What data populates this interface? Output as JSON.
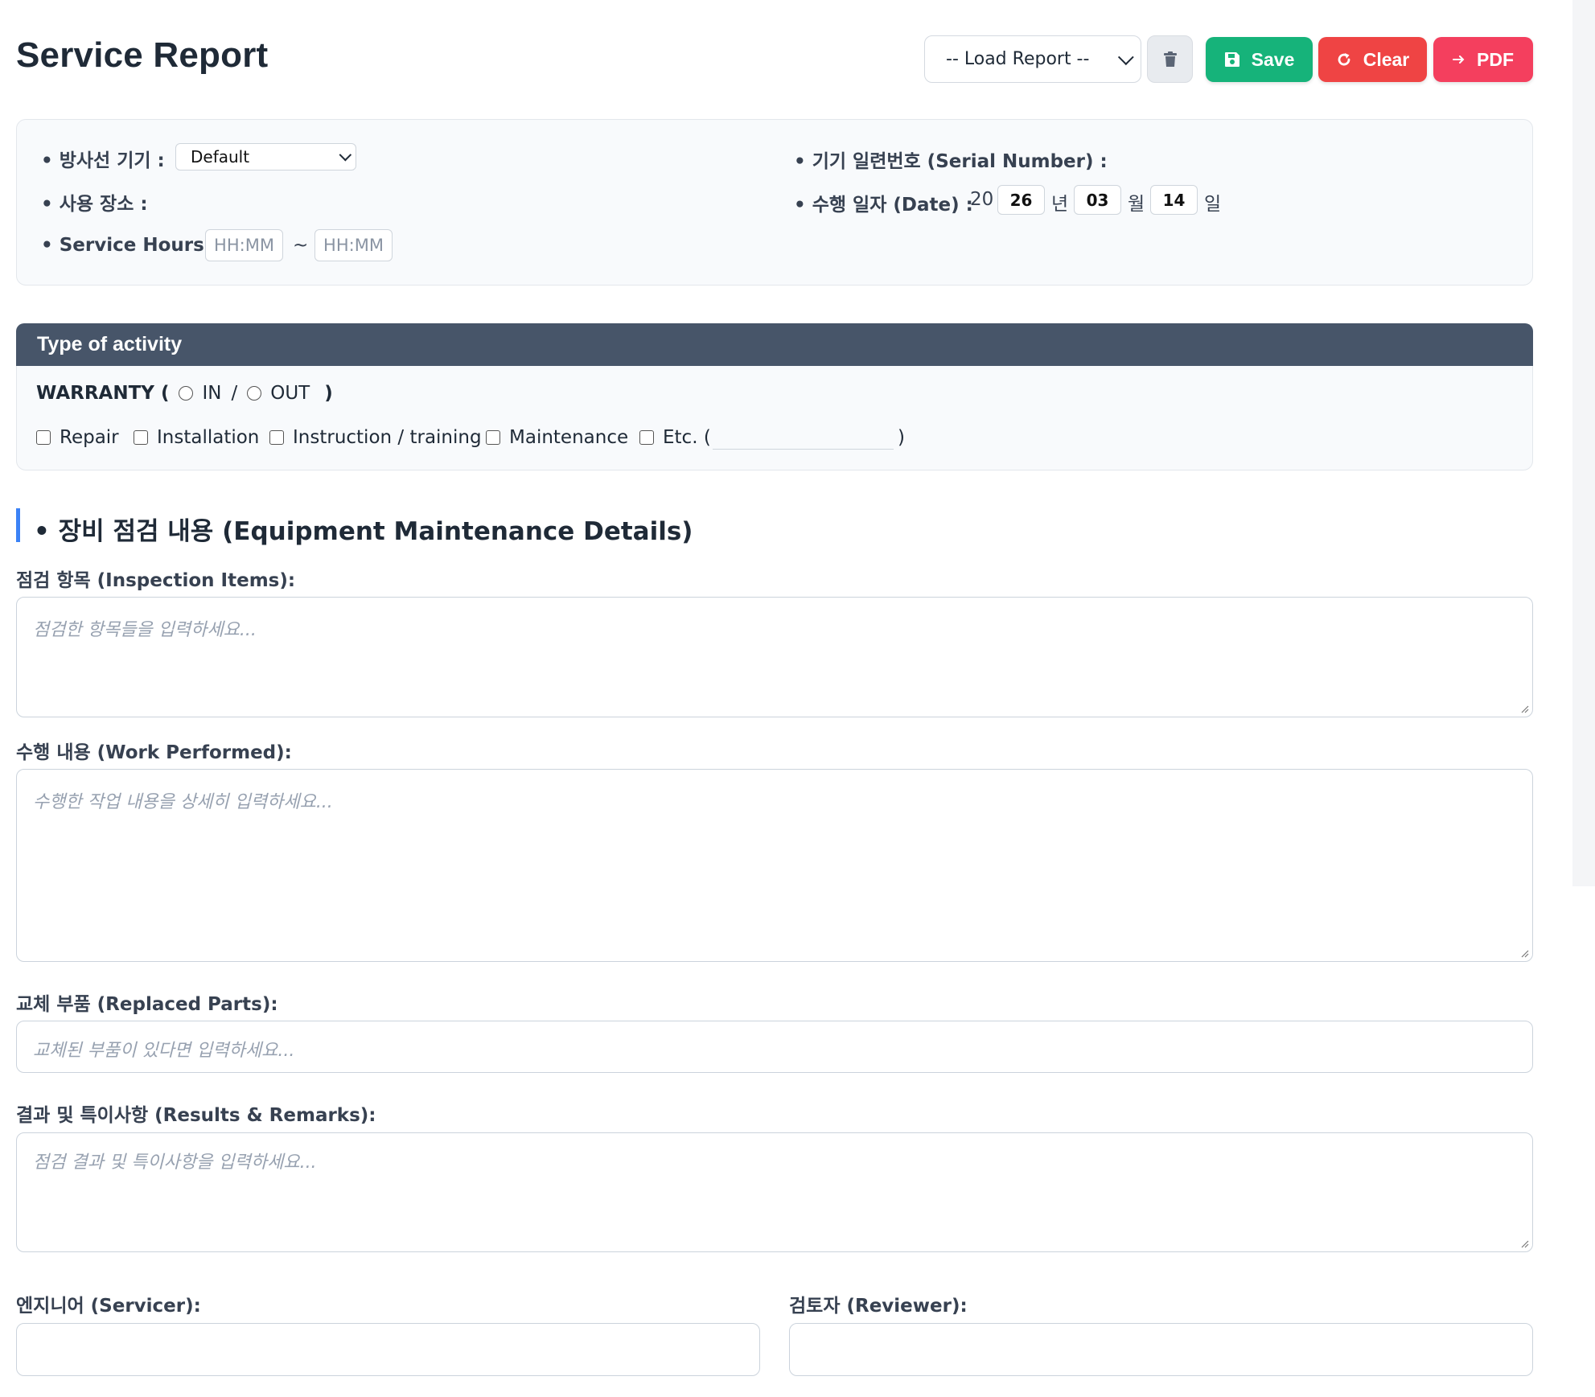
{
  "app": {
    "title": "Service Report"
  },
  "toolbar": {
    "load_report": "-- Load Report --",
    "delete_icon": "trash-icon",
    "save_label": "Save",
    "clear_label": "Clear",
    "pdf_label": "PDF",
    "colors": {
      "save": "#16b37a",
      "clear": "#ef4444",
      "pdf": "#f43f5e"
    }
  },
  "info": {
    "device_label": "• 방사선 기기 :",
    "device_value": "Default",
    "location_label": "• 사용 장소 :",
    "hours_label": "• Service Hours :",
    "hours_start_placeholder": "HH:MM",
    "hours_sep": "~",
    "hours_end_placeholder": "HH:MM",
    "serial_label": "• 기기 일련번호 (Serial Number) :",
    "date_label": "• 수행 일자 (Date) :",
    "year_prefix": "20",
    "year": "26",
    "year_unit": "년",
    "month": "03",
    "month_unit": "월",
    "day": "14",
    "day_unit": "일"
  },
  "activity": {
    "header": "Type of activity",
    "warranty_label": "WARRANTY (",
    "warranty_in": "IN",
    "warranty_sep": "/",
    "warranty_out": "OUT",
    "warranty_close": ")",
    "options": [
      "Repair",
      "Installation",
      "Instruction / training",
      "Maintenance",
      "Etc. ("
    ],
    "etc_close": ")"
  },
  "maintenance": {
    "section_title": "• 장비 점검 내용 (Equipment Maintenance Details)",
    "inspection_label": "점검 항목 (Inspection Items):",
    "inspection_placeholder": "점검한 항목들을 입력하세요...",
    "work_label": "수행 내용 (Work Performed):",
    "work_placeholder": "수행한 작업 내용을 상세히 입력하세요...",
    "parts_label": "교체 부품 (Replaced Parts):",
    "parts_placeholder": "교체된 부품이 있다면 입력하세요...",
    "results_label": "결과 및 특이사항 (Results & Remarks):",
    "results_placeholder": "점검 결과 및 특이사항을 입력하세요...",
    "servicer_label": "엔지니어 (Servicer):",
    "reviewer_label": "검토자 (Reviewer):"
  }
}
